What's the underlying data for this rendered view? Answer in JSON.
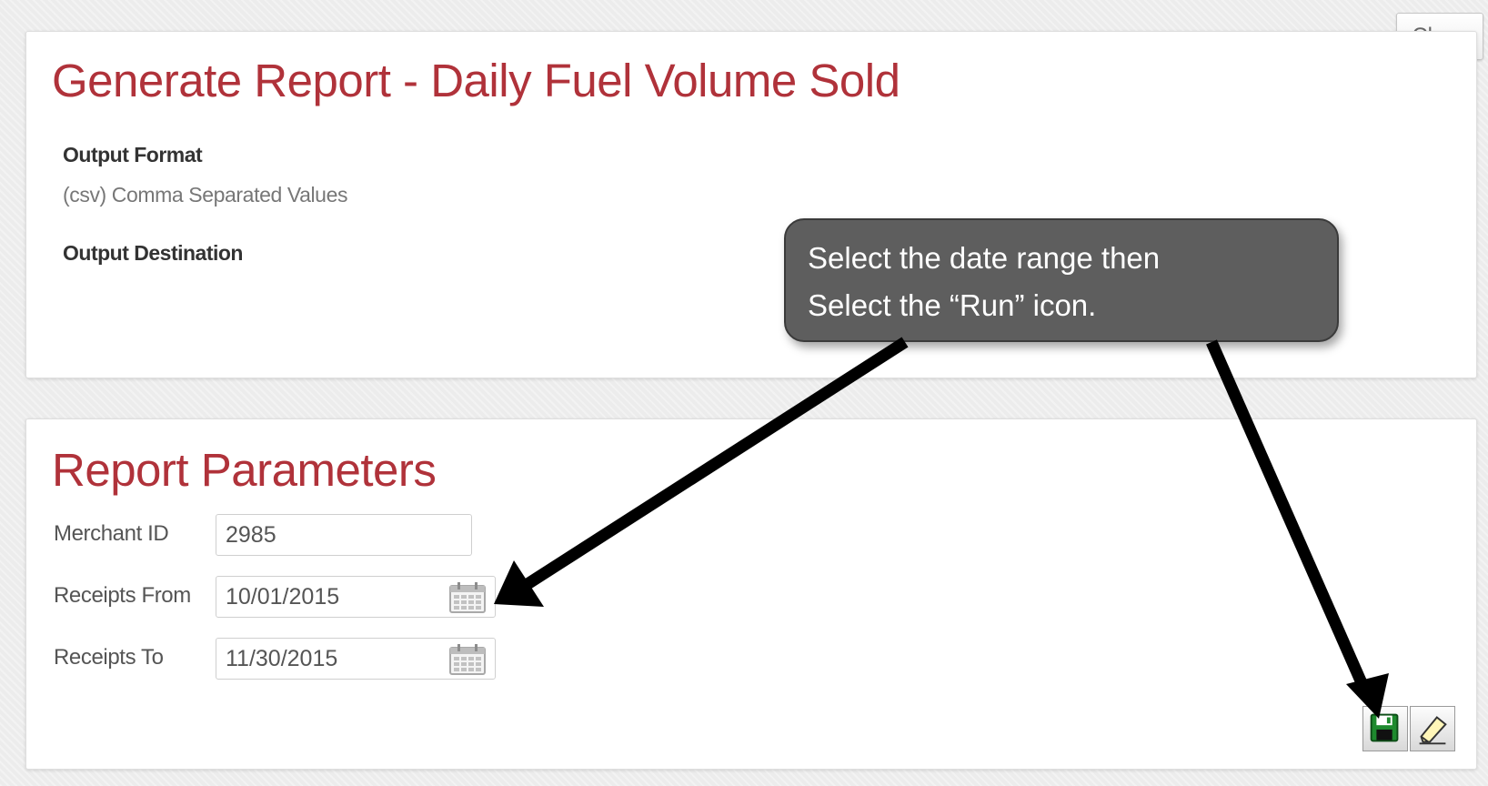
{
  "close_label": "Close",
  "report": {
    "title": "Generate Report - Daily Fuel Volume Sold",
    "output_format_label": "Output Format",
    "output_format_value": "(csv) Comma Separated Values",
    "output_destination_label": "Output Destination"
  },
  "params": {
    "title": "Report Parameters",
    "merchant_id_label": "Merchant ID",
    "merchant_id_value": "2985",
    "receipts_from_label": "Receipts From",
    "receipts_from_value": "10/01/2015",
    "receipts_to_label": "Receipts To",
    "receipts_to_value": "11/30/2015"
  },
  "callout": {
    "line1": "Select the date range then",
    "line2": "Select the “Run” icon."
  },
  "icons": {
    "calendar": "calendar-icon",
    "run": "save-disk-icon",
    "clear": "eraser-icon"
  },
  "colors": {
    "title": "#b0323a",
    "callout_bg": "#5e5e5e",
    "run_icon": "#1e8a2e"
  }
}
